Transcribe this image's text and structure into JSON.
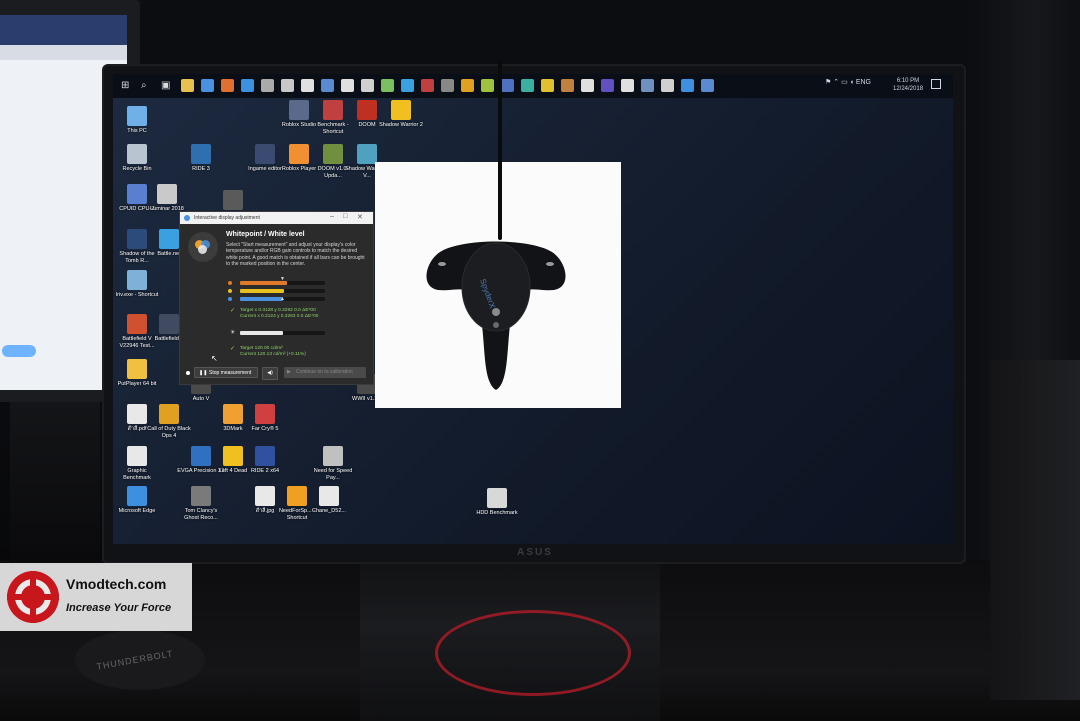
{
  "taskbar": {
    "tray_lang": "ENG",
    "time": "6:10 PM",
    "date": "12/24/2018",
    "icons": [
      "start-icon",
      "search-icon",
      "task-view-icon",
      "file-explorer-icon",
      "store-icon",
      "firefox-icon",
      "edge-icon",
      "calculator-icon",
      "app-icon",
      "app-icon",
      "app-icon",
      "app-icon",
      "app-icon",
      "app-icon",
      "app-icon",
      "app-icon",
      "app-icon",
      "app-icon",
      "app-icon",
      "app-icon",
      "app-icon",
      "app-icon",
      "app-icon",
      "app-icon",
      "app-icon",
      "app-icon",
      "app-icon",
      "app-icon",
      "app-icon",
      "app-icon"
    ]
  },
  "desktop_icons": [
    {
      "label": "This PC",
      "color": "#6fb0e8"
    },
    {
      "label": "Recycle Bin",
      "color": "#b8c4d0"
    },
    {
      "label": "CPUID CPU-Z",
      "color": "#5a7fd0"
    },
    {
      "label": "Luminar 2018",
      "color": "#c9c9c9"
    },
    {
      "label": "Shadow of the Tomb R...",
      "color": "#2c4a7a"
    },
    {
      "label": "Battle.net",
      "color": "#3aa0e0"
    },
    {
      "label": "Iriv.exe - Shortcut",
      "color": "#7fb0d8"
    },
    {
      "label": "Battlefield V V22946 Test...",
      "color": "#d05030"
    },
    {
      "label": "Battlefield 4",
      "color": "#404a60"
    },
    {
      "label": "PutPlayer 64 bit",
      "color": "#f0c040"
    },
    {
      "label": "สำลี.pdf",
      "color": "#e8e8e8"
    },
    {
      "label": "Call of Duty Black Ops 4",
      "color": "#e0a020"
    },
    {
      "label": "3DMark",
      "color": "#f0a030"
    },
    {
      "label": "Far Cry® 5",
      "color": "#d04040"
    },
    {
      "label": "Graphic Benchmark",
      "color": "#e8e8e8"
    },
    {
      "label": "EVGA Precision X1",
      "color": "#3070c0"
    },
    {
      "label": "Left 4 Dead",
      "color": "#f0c020"
    },
    {
      "label": "RIDE 2 x64",
      "color": "#3050a0"
    },
    {
      "label": "Need for Speed Pay...",
      "color": "#c0c0c0"
    },
    {
      "label": "Microsoft Edge",
      "color": "#3d8fe0"
    },
    {
      "label": "Tom Clancy's Ghost Reco...",
      "color": "#7a7a7a"
    },
    {
      "label": "สำลี.jpg",
      "color": "#e8e8e8"
    },
    {
      "label": "NeedForSp... - Shortcut",
      "color": "#f0a020"
    },
    {
      "label": "Chane_D52...",
      "color": "#e8e8e8"
    },
    {
      "label": "HDD Benchmark",
      "color": "#d8d8d8"
    },
    {
      "label": "RIDE 3",
      "color": "#2e6fb0"
    },
    {
      "label": "Ingame editor",
      "color": "#3a4a70"
    },
    {
      "label": "Roblox Player",
      "color": "#f09030"
    },
    {
      "label": "DOOM v1.0-Upda...",
      "color": "#709040"
    },
    {
      "label": "Shadow Warrior 2 V...",
      "color": "#50a0c0"
    },
    {
      "label": "Roblox Studio",
      "color": "#5a6a8a"
    },
    {
      "label": "Benchmark - Shortcut",
      "color": "#c04040"
    },
    {
      "label": "DOOM",
      "color": "#c03020"
    },
    {
      "label": "Shadow Warrior 2",
      "color": "#f0c020"
    },
    {
      "label": "Tom Clancy's",
      "color": "#5a5a5a"
    },
    {
      "label": "Auto V",
      "color": "#4a4a4a"
    },
    {
      "label": "WWII v1.3...",
      "color": "#4a4a4a"
    }
  ],
  "dialog": {
    "title": "Interactive display adjustment",
    "heading": "Whitepoint / White level",
    "description": "Select \"Start measurement\" and adjust your display's color temperature and/or RGB gain controls to match the desired white point. A good match is obtained if all bars can be brought to the marked position in the center.",
    "target_xy": "Target x 0.3128 y 0.3292 0.0 ΔE*00",
    "current_xy": "Current x 0.3124 y 0.3283 0.0 ΔE*00",
    "target_lum": "Target 120.00 cd/m²",
    "current_lum": "Current 120.13 cd/m² (+0.11%)",
    "stop_button": "Stop measurement",
    "continue_button": "Continue on to calibration",
    "bars": [
      {
        "color": "#e07a2a",
        "fill": 0.55
      },
      {
        "color": "#e8c020",
        "fill": 0.52
      },
      {
        "color": "#4a90e0",
        "fill": 0.5
      }
    ],
    "lum_fill": 0.5
  },
  "device": {
    "brand_text": "SpyderX"
  },
  "monitor": {
    "brand": "ASUS"
  },
  "watermark": {
    "title": "Vmodtech.com",
    "slogan": "Increase Your Force"
  },
  "puck": {
    "text": "THUNDERBOLT"
  }
}
